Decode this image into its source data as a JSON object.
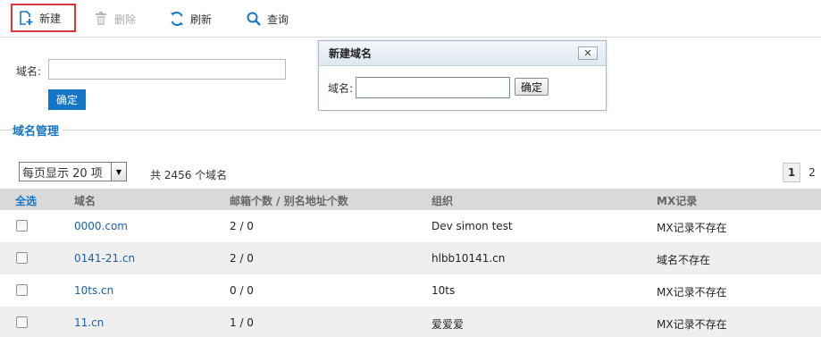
{
  "toolbar": {
    "new_label": "新建",
    "delete_label": "删除",
    "refresh_label": "刷新",
    "query_label": "查询"
  },
  "search_form": {
    "domain_label": "域名:",
    "domain_value": "",
    "confirm_label": "确定"
  },
  "dialog": {
    "title": "新建域名",
    "close_label": "✕",
    "domain_label": "域名:",
    "domain_value": "",
    "confirm_label": "确定"
  },
  "section": {
    "title": "域名管理"
  },
  "pager": {
    "page_size_selected": "每页显示 20 项",
    "total_text": "共 2456 个域名",
    "pages": [
      "1",
      "2"
    ],
    "current_page": "1"
  },
  "table": {
    "headers": {
      "select_all": "全选",
      "domain": "域名",
      "counts": "邮箱个数 / 别名地址个数",
      "org": "组织",
      "mx": "MX记录"
    },
    "rows": [
      {
        "domain": "0000.com",
        "counts": "2 / 0",
        "org": "Dev simon test",
        "mx": "MX记录不存在"
      },
      {
        "domain": "0141-21.cn",
        "counts": "2 / 0",
        "org": "hlbb10141.cn",
        "mx": "域名不存在"
      },
      {
        "domain": "10ts.cn",
        "counts": "0 / 0",
        "org": "10ts",
        "mx": "MX记录不存在"
      },
      {
        "domain": "11.cn",
        "counts": "1 / 0",
        "org": "爱爱爱",
        "mx": "MX记录不存在"
      }
    ]
  },
  "colors": {
    "accent": "#1576c5",
    "link": "#1c5fa8",
    "highlight": "#d9373c"
  }
}
